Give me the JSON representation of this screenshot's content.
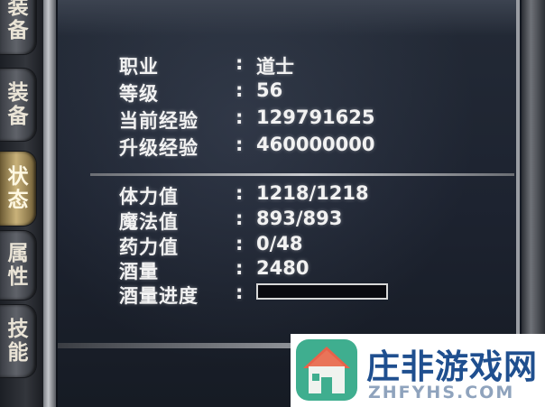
{
  "tabs": [
    {
      "label": "装备",
      "active": false
    },
    {
      "label": "状态",
      "active": true
    },
    {
      "label": "属性",
      "active": false
    },
    {
      "label": "技能",
      "active": false
    }
  ],
  "stats_top": [
    {
      "label": "职业",
      "value": "道士"
    },
    {
      "label": "等级",
      "value": "56"
    },
    {
      "label": "当前经验",
      "value": "129791625"
    },
    {
      "label": "升级经验",
      "value": "460000000"
    }
  ],
  "stats_bottom": [
    {
      "label": "体力值",
      "value": "1218/1218"
    },
    {
      "label": "魔法值",
      "value": "893/893"
    },
    {
      "label": "药力值",
      "value": "0/48"
    },
    {
      "label": "酒量",
      "value": "2480"
    },
    {
      "label": "酒量进度",
      "value": ""
    }
  ],
  "colon": ":",
  "drunk_progress": 0,
  "colors": {
    "text": "#f2f2f2",
    "panel": "#1d2330",
    "active_tab": "#c9b27a"
  },
  "watermark": {
    "title": "庄非游戏网",
    "domain": "ZHFYHS.COM",
    "icon": "house-logo-icon"
  }
}
